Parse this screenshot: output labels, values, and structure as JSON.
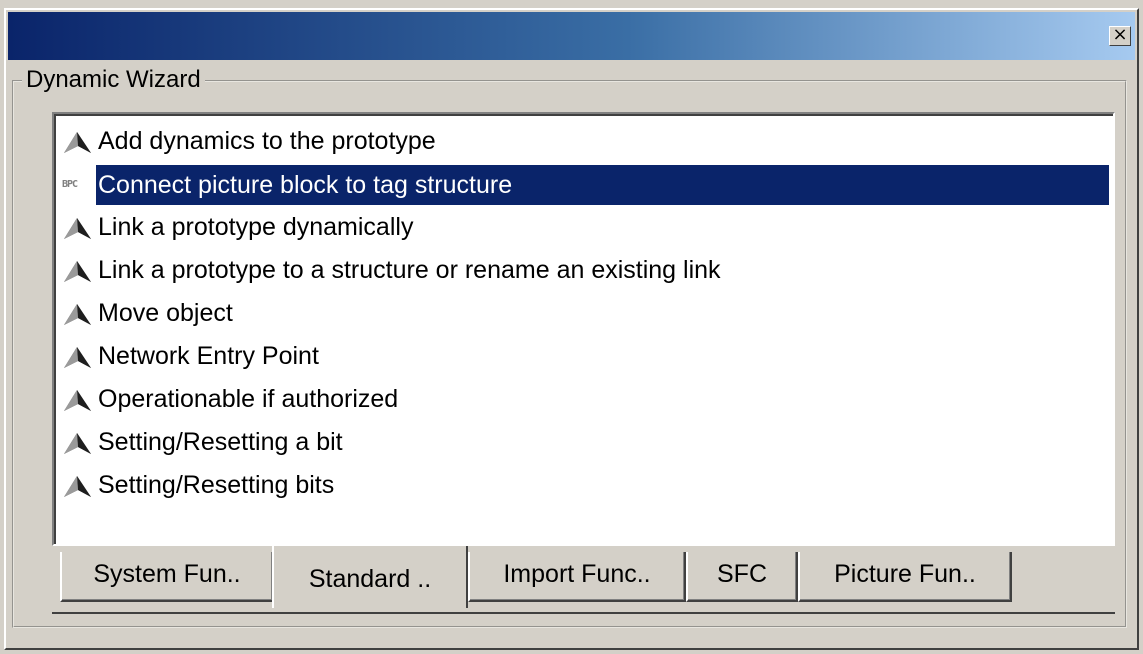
{
  "window": {
    "title": "",
    "close_label": "×"
  },
  "group": {
    "legend": "Dynamic Wizard"
  },
  "list": {
    "items": [
      {
        "label": "Add dynamics to the prototype",
        "icon": "wizard-hat-icon",
        "selected": false
      },
      {
        "label": "Connect picture block to tag structure",
        "icon": "bpc-icon",
        "icon_text": "BPC",
        "selected": true
      },
      {
        "label": "Link a prototype dynamically",
        "icon": "wizard-hat-icon",
        "selected": false
      },
      {
        "label": "Link a prototype to a structure or rename an existing link",
        "icon": "wizard-hat-icon",
        "selected": false
      },
      {
        "label": "Move object",
        "icon": "wizard-hat-icon",
        "selected": false
      },
      {
        "label": "Network Entry Point",
        "icon": "wizard-hat-icon",
        "selected": false
      },
      {
        "label": "Operationable if authorized",
        "icon": "wizard-hat-icon",
        "selected": false
      },
      {
        "label": "Setting/Resetting a bit",
        "icon": "wizard-hat-icon",
        "selected": false
      },
      {
        "label": "Setting/Resetting bits",
        "icon": "wizard-hat-icon",
        "selected": false
      }
    ]
  },
  "tabs": [
    {
      "label": "System Fun..",
      "active": false
    },
    {
      "label": "Standard ..",
      "active": true
    },
    {
      "label": "Import Func..",
      "active": false
    },
    {
      "label": "SFC",
      "active": false
    },
    {
      "label": "Picture Fun..",
      "active": false
    }
  ],
  "colors": {
    "selection": "#0a246a",
    "titlebar_start": "#0a246a",
    "titlebar_end": "#a6caf0"
  }
}
